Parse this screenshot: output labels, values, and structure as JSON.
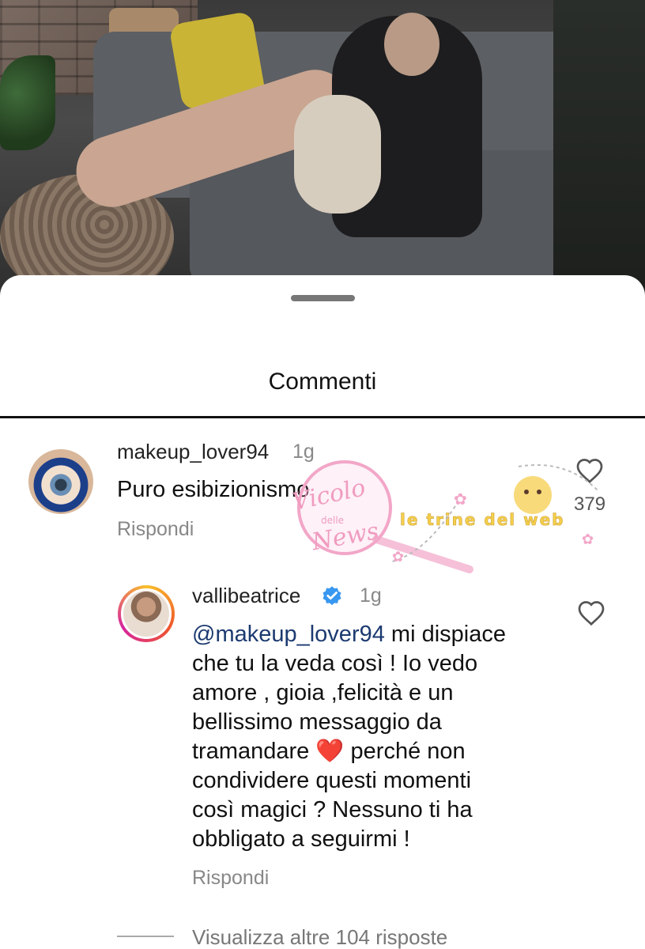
{
  "sheet": {
    "title": "Commenti"
  },
  "comments": [
    {
      "username": "makeup_lover94",
      "time": "1g",
      "text": "Puro esibizionismo",
      "reply_label": "Rispondi",
      "likes": "379",
      "avatar_icon": "eye-makeup-avatar"
    }
  ],
  "reply": {
    "username": "vallibeatrice",
    "verified": true,
    "time": "1g",
    "mention": "@makeup_lover94",
    "lines": [
      " mi dispiace",
      "che tu la veda così ! Io vedo",
      "amore , gioia ,felicità e un",
      "bellissimo messaggio da",
      "tramandare ",
      " perché non",
      "condividere questi momenti",
      "così magici ?  Nessuno ti ha",
      "obbligato a seguirmi !"
    ],
    "heart_emoji": "❤️",
    "reply_label": "Rispondi"
  },
  "more_replies": "Visualizza altre 104 risposte",
  "watermark": {
    "text1": "Vicolo",
    "text2": "delle",
    "text3": "News",
    "text4": "le trine del web"
  },
  "colors": {
    "mention": "#1c3a70",
    "verified": "#3897f0",
    "muted": "#888888",
    "heart_red": "#e0212c"
  }
}
